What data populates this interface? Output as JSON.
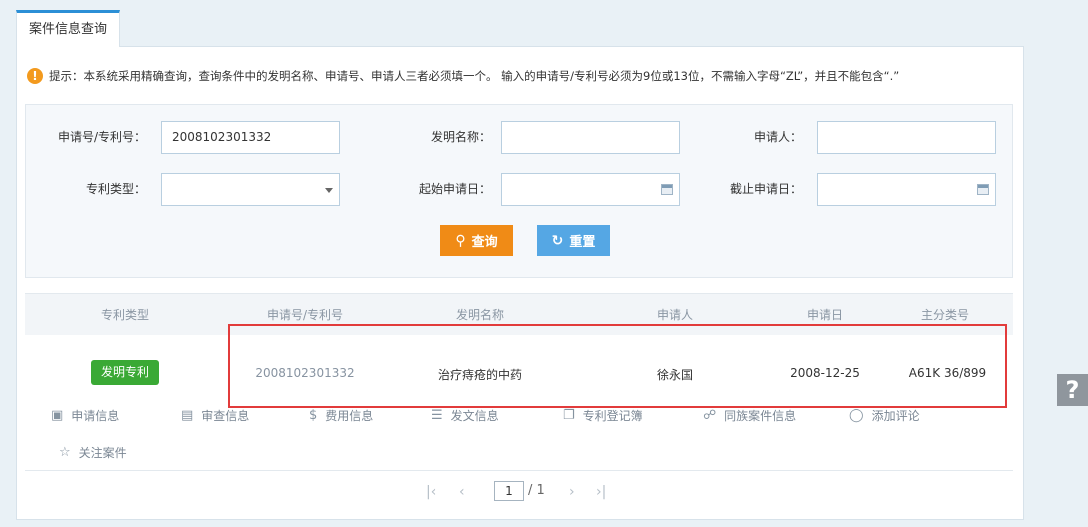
{
  "tab": {
    "label": "案件信息查询"
  },
  "tip": {
    "text": "提示：本系统采用精确查询，查询条件中的发明名称、申请号、申请人三者必须填一个。 输入的申请号/专利号必须为9位或13位，不需输入字母“ZL”，并且不能包含“.”"
  },
  "form": {
    "app_no_label": "申请号/专利号：",
    "app_no_value": "2008102301332",
    "invention_name_label": "发明名称：",
    "invention_name_value": "",
    "applicant_label": "申请人：",
    "applicant_value": "",
    "patent_type_label": "专利类型：",
    "patent_type_value": "",
    "start_date_label": "起始申请日：",
    "start_date_value": "",
    "end_date_label": "截止申请日：",
    "end_date_value": "",
    "query_label": "查询",
    "reset_label": "重置"
  },
  "table": {
    "headers": [
      "专利类型",
      "申请号/专利号",
      "发明名称",
      "申请人",
      "申请日",
      "主分类号"
    ],
    "rows": [
      {
        "type": "发明专利",
        "app_no": "2008102301332",
        "name": "治疗痔疮的中药",
        "applicant": "徐永国",
        "date": "2008-12-25",
        "class": "A61K 36/899"
      }
    ],
    "actions": [
      "申请信息",
      "审查信息",
      "费用信息",
      "发文信息",
      "专利登记簿",
      "同族案件信息",
      "添加评论",
      "关注案件"
    ]
  },
  "pager": {
    "current": "1",
    "total": "/ 1"
  },
  "help": {
    "label": "?"
  },
  "colors": {
    "accent": "#2b8fd6",
    "query": "#f08b16",
    "reset": "#55a7e4",
    "badge": "#3aa935",
    "highlight": "#e23b3b"
  }
}
